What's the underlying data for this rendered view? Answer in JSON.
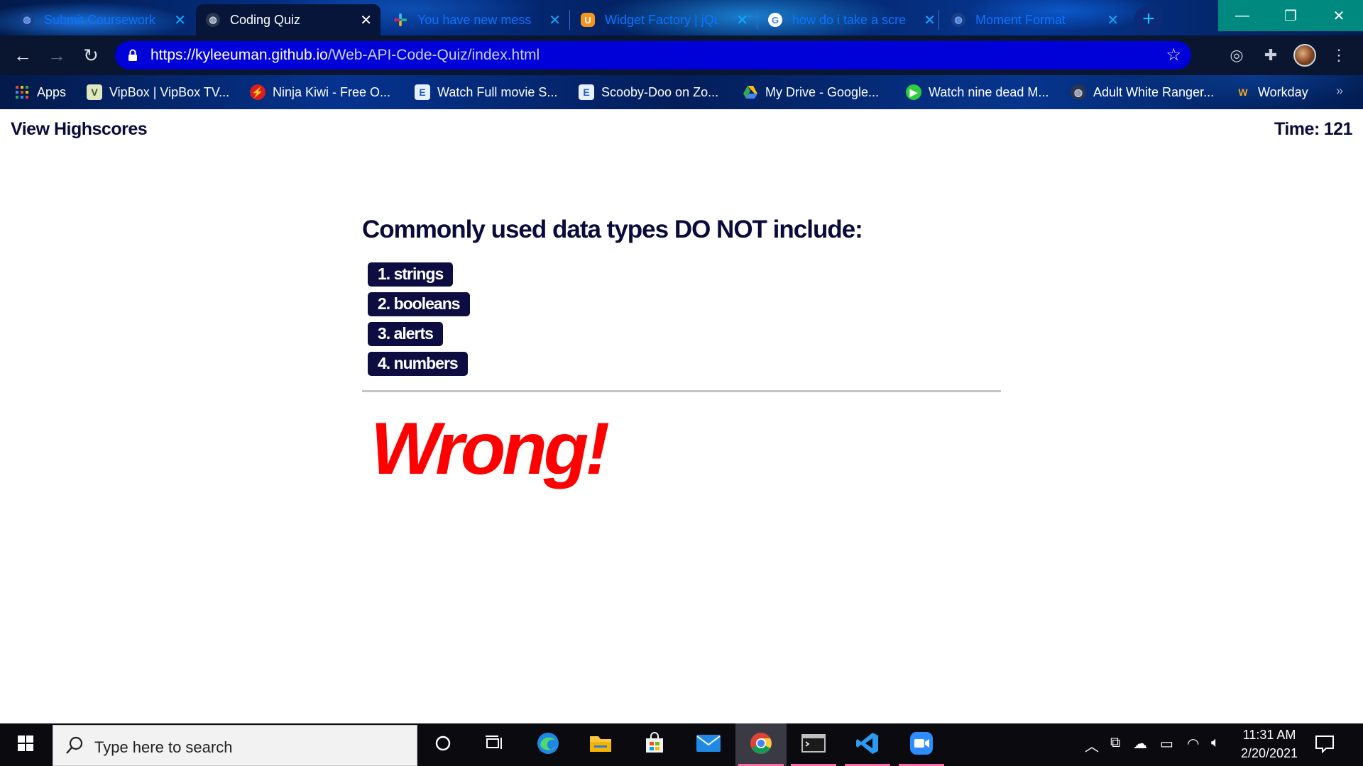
{
  "browser": {
    "tabs": [
      {
        "title": "Submit Coursework | ",
        "active": false,
        "icon": "globe-icon"
      },
      {
        "title": "Coding Quiz",
        "active": true,
        "icon": "globe-icon"
      },
      {
        "title": "You have new messa",
        "active": false,
        "icon": "slack-icon"
      },
      {
        "title": "Widget Factory | jQu",
        "active": false,
        "icon": "jquery-ui-icon"
      },
      {
        "title": "how do i take a scre",
        "active": false,
        "icon": "google-icon"
      },
      {
        "title": "Moment Format",
        "active": false,
        "icon": "globe-icon"
      }
    ],
    "new_tab_label": "+",
    "window_controls": {
      "minimize": "—",
      "maximize": "❐",
      "close": "✕"
    },
    "url": {
      "scheme": "https://",
      "host": "kyleeuman.github.io",
      "path": "/Web-API-Code-Quiz/index.html"
    },
    "bookmarks": [
      {
        "label": "Apps",
        "icon": "apps-grid-icon"
      },
      {
        "label": "VipBox | VipBox TV...",
        "icon": "vipbox-icon"
      },
      {
        "label": "Ninja Kiwi - Free O...",
        "icon": "ninja-kiwi-icon"
      },
      {
        "label": "Watch Full movie S...",
        "icon": "page-icon"
      },
      {
        "label": "Scooby-Doo on Zo...",
        "icon": "page-icon"
      },
      {
        "label": "My Drive - Google...",
        "icon": "google-drive-icon"
      },
      {
        "label": "Watch nine dead M...",
        "icon": "green-play-icon"
      },
      {
        "label": "Adult White Ranger...",
        "icon": "globe-icon"
      },
      {
        "label": "Workday",
        "icon": "workday-icon"
      }
    ],
    "bookmarks_more": "»"
  },
  "page": {
    "view_highscores": "View Highscores",
    "timer_label": "Time:",
    "timer_value": "121",
    "question": "Commonly used data types DO NOT include:",
    "choices": [
      "1. strings",
      "2. booleans",
      "3. alerts",
      "4. numbers"
    ],
    "feedback": "Wrong!",
    "colors": {
      "text": "#0b0b3b",
      "button": "#0d0d42",
      "feedback": "#ff0000",
      "divider": "#c4c4c4"
    }
  },
  "taskbar": {
    "search_placeholder": "Type here to search",
    "apps": [
      "cortana-icon",
      "task-view-icon",
      "edge-icon",
      "file-explorer-icon",
      "store-icon",
      "mail-icon",
      "chrome-icon",
      "terminal-icon",
      "vscode-icon",
      "zoom-icon"
    ],
    "active_app": "chrome-icon",
    "clock": {
      "time": "11:31 AM",
      "date": "2/20/2021"
    }
  }
}
